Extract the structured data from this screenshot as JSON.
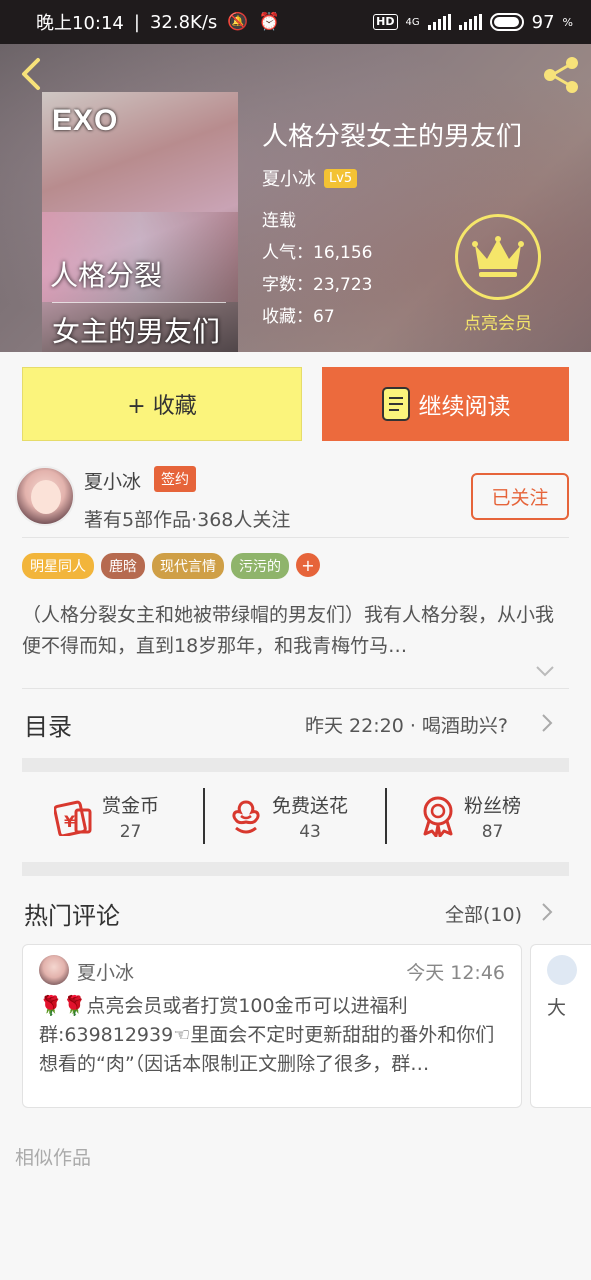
{
  "status_bar": {
    "time": "晚上10:14",
    "speed": "32.8K/s",
    "hd": "HD",
    "network": "4G",
    "battery": "97"
  },
  "book": {
    "cover_exo": "EXO",
    "cover_line1": "人格分裂",
    "cover_line2": "女主的男友们",
    "title": "人格分裂女主的男友们",
    "author": "夏小冰",
    "level": "Lv5",
    "status": "连载",
    "popularity": "人气：16,156",
    "words": "字数：23,723",
    "favorites": "收藏：67",
    "vip_label": "点亮会员"
  },
  "actions": {
    "collect": "+ 收藏",
    "read": "继续阅读"
  },
  "author_card": {
    "name": "夏小冰",
    "badge": "签约",
    "stats": "著有5部作品·368人关注",
    "follow": "已关注"
  },
  "tags": [
    {
      "label": "明星同人",
      "color": "#f2b53b"
    },
    {
      "label": "鹿晗",
      "color": "#b66a4f"
    },
    {
      "label": "现代言情",
      "color": "#cf9f46"
    },
    {
      "label": "污污的",
      "color": "#8fb46b"
    }
  ],
  "tag_more": "+",
  "synopsis": "（人格分裂女主和她被带绿帽的男友们）我有人格分裂，从小我便不得而知，直到18岁那年，和我青梅竹马…",
  "catalog": {
    "label": "目录",
    "latest": "昨天 22:20 · 喝酒助兴?"
  },
  "stats": [
    {
      "label": "赏金币",
      "value": "27",
      "icon": "red-envelope-icon"
    },
    {
      "label": "免费送花",
      "value": "43",
      "icon": "flower-icon"
    },
    {
      "label": "粉丝榜",
      "value": "87",
      "icon": "medal-icon"
    }
  ],
  "comments": {
    "label": "热门评论",
    "all": "全部(10)",
    "items": [
      {
        "name": "夏小冰",
        "time": "今天 12:46",
        "text": "🌹🌹点亮会员或者打赏100金币可以进福利群:639812939☜里面会不定时更新甜甜的番外和你们想看的“肉”（因话本限制正文删除了很多，群…"
      }
    ],
    "next_preview": "大"
  },
  "similar": "相似作品",
  "colors": {
    "accent": "#e6643a",
    "collect_bg": "#fbf47c",
    "read_bg": "#ec6a3d",
    "vip": "#f5e66a",
    "icon_red": "#d8382e"
  }
}
